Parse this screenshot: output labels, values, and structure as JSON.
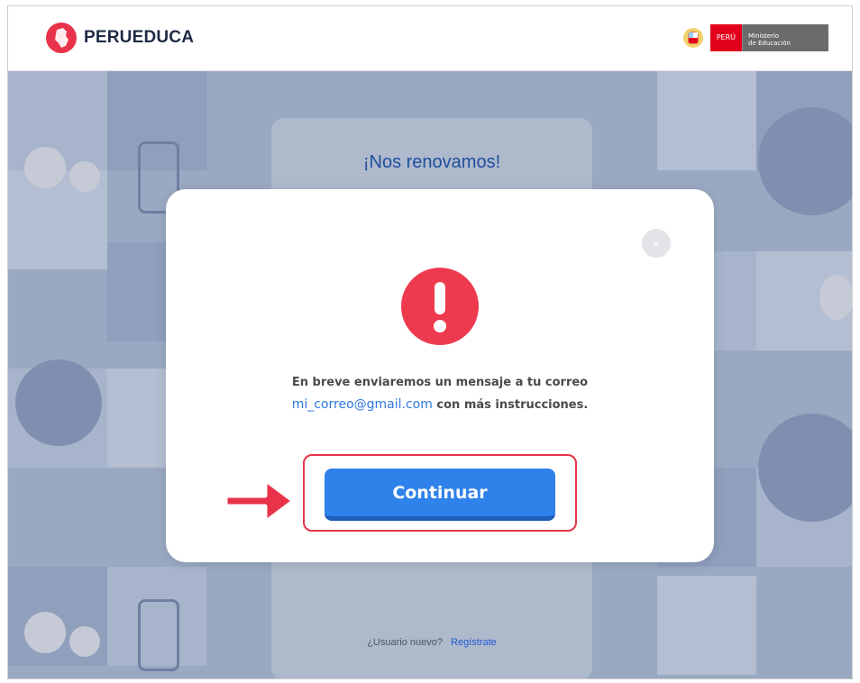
{
  "header": {
    "logo_text": "PERUEDUCA",
    "gov_peru": "PERÚ",
    "gov_ministry_line1": "Ministerio",
    "gov_ministry_line2": "de Educación"
  },
  "login": {
    "title": "¡Nos renovamos!",
    "new_user_text": "¿Usuario nuevo?",
    "register_link": "Regístrate"
  },
  "modal": {
    "message_line1": "En breve enviaremos un mensaje a tu correo",
    "email": "mi_correo@gmail.com",
    "message_line2_suffix": "con más instrucciones.",
    "close_symbol": "×",
    "continue_label": "Continuar"
  },
  "colors": {
    "brand_red": "#e8334a",
    "button_blue": "#2f82ea",
    "email_blue": "#2f77e0",
    "title_blue": "#1e4e9c"
  },
  "icons": [
    "peru-educa-logo-icon",
    "government-shield-icon",
    "alert-exclamation-icon",
    "close-icon",
    "red-arrow-icon"
  ]
}
